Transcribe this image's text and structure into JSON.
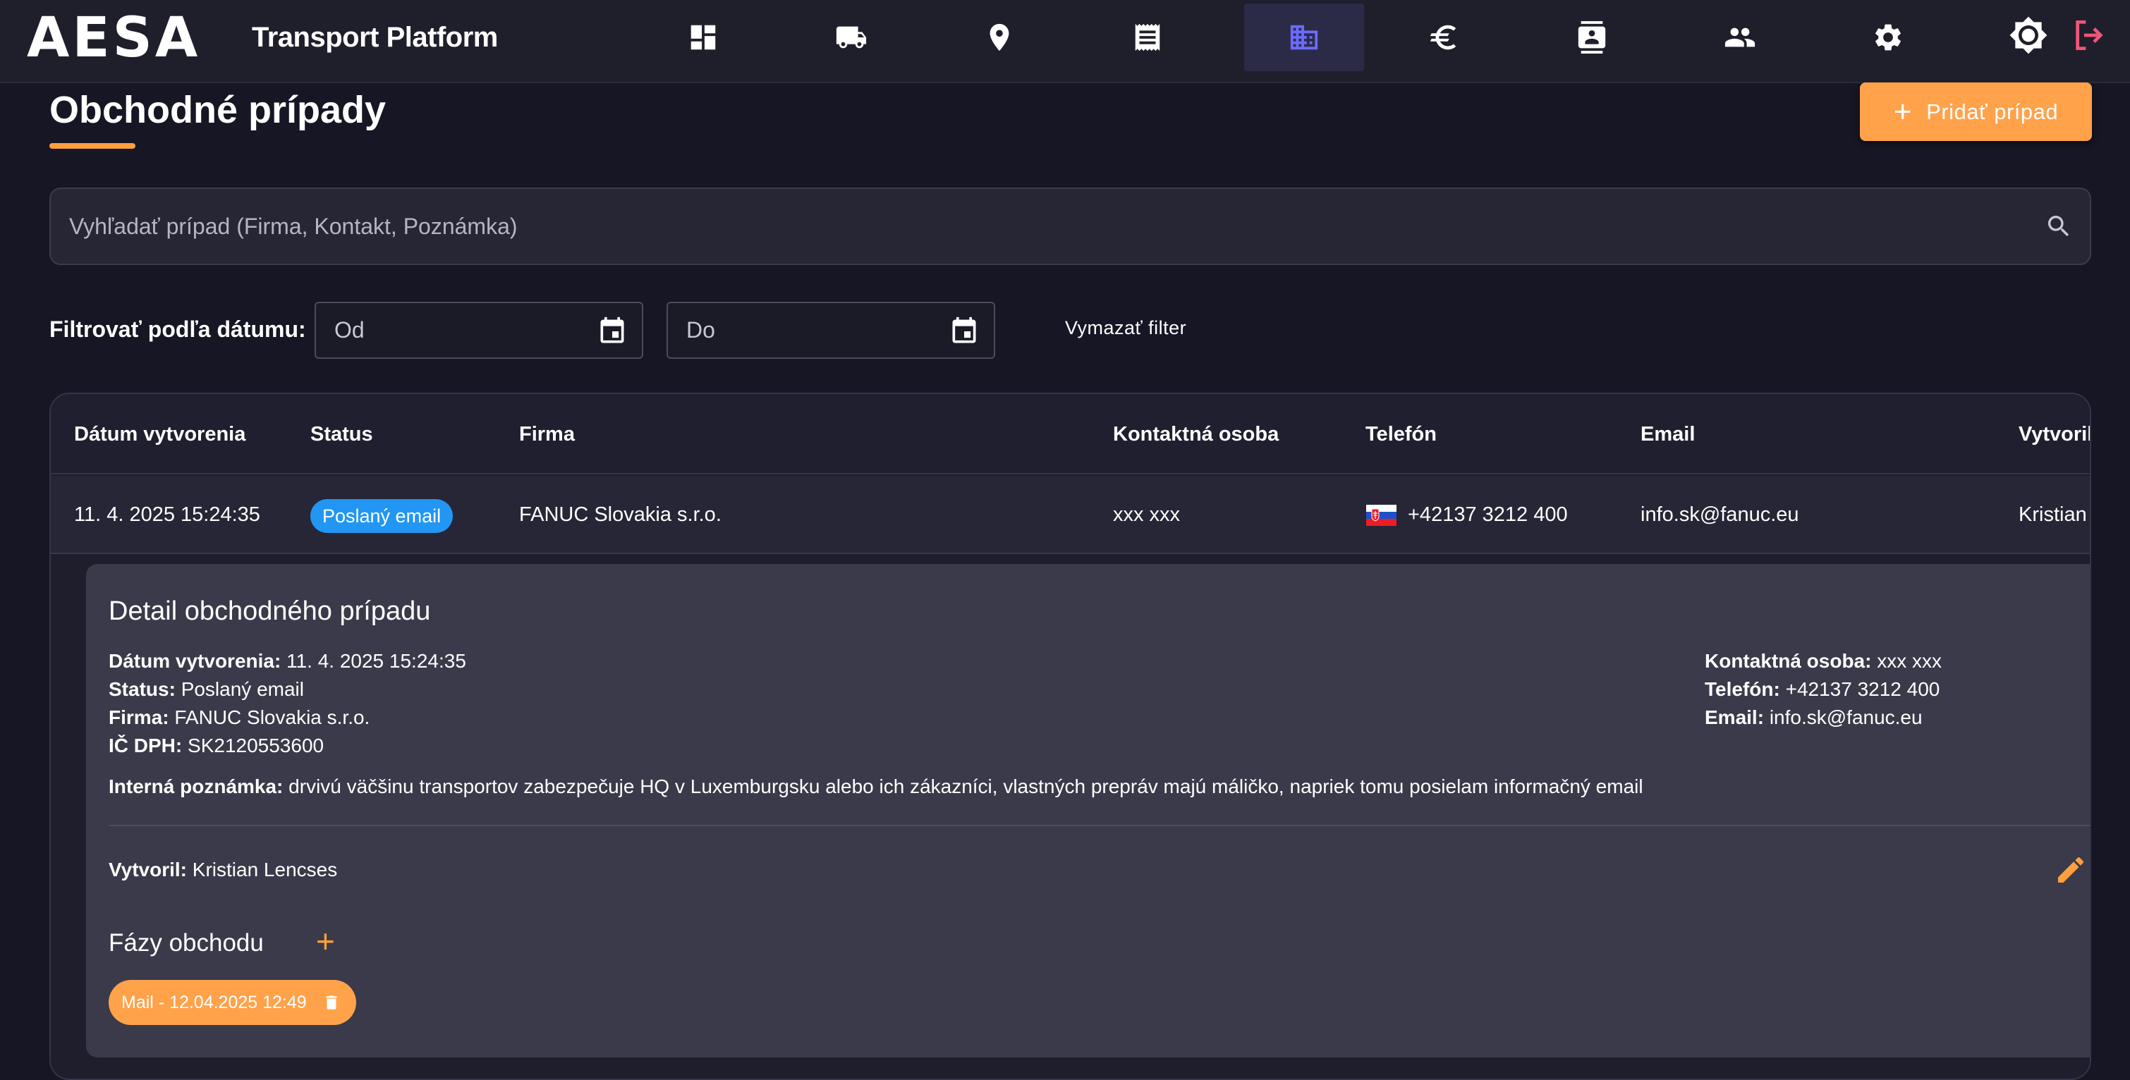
{
  "app": {
    "logo": "AESA",
    "name": "Transport Platform"
  },
  "nav": [
    {
      "icon": "dashboard-icon"
    },
    {
      "icon": "truck-icon"
    },
    {
      "icon": "location-pin-icon"
    },
    {
      "icon": "receipt-icon"
    },
    {
      "icon": "business-icon",
      "active": true
    },
    {
      "icon": "euro-icon"
    },
    {
      "icon": "contacts-icon"
    },
    {
      "icon": "people-icon"
    },
    {
      "icon": "gear-icon"
    }
  ],
  "header_right": [
    "theme-toggle-icon",
    "logout-icon"
  ],
  "page": {
    "title": "Obchodné prípady",
    "add_button": "Pridať prípad"
  },
  "search": {
    "placeholder": "Vyhľadať prípad (Firma, Kontakt, Poznámka)"
  },
  "filter": {
    "label": "Filtrovať podľa dátumu:",
    "from_placeholder": "Od",
    "to_placeholder": "Do",
    "clear": "Vymazať filter"
  },
  "table": {
    "headers": [
      "Dátum vytvorenia",
      "Status",
      "Firma",
      "Kontaktná osoba",
      "Telefón",
      "Email",
      "Vytvoril"
    ],
    "rows": [
      {
        "date": "11. 4. 2025 15:24:35",
        "status": "Poslaný email",
        "company": "FANUC Slovakia s.r.o.",
        "contact": "xxx xxx",
        "phone": "+42137 3212 400",
        "email": "info.sk@fanuc.eu",
        "created_by": "Kristian"
      }
    ]
  },
  "detail": {
    "title": "Detail obchodného prípadu",
    "date_label": "Dátum vytvorenia:",
    "date": "11. 4. 2025 15:24:35",
    "status_label": "Status:",
    "status": "Poslaný email",
    "company_label": "Firma:",
    "company": "FANUC Slovakia s.r.o.",
    "vat_label": "IČ DPH:",
    "vat": "SK2120553600",
    "contact_label": "Kontaktná osoba:",
    "contact": "xxx xxx",
    "phone_label": "Telefón:",
    "phone": "+42137 3212 400",
    "email_label": "Email:",
    "email": "info.sk@fanuc.eu",
    "note_label": "Interná poznámka:",
    "note": "drvivú väčšinu transportov zabezpečuje HQ v Luxemburgsku alebo ich zákazníci, vlastných prepráv majú máličko, napriek tomu posielam informačný email",
    "creator_label": "Vytvoril:",
    "creator": "Kristian Lencses",
    "phases_title": "Fázy obchodu",
    "phases": [
      {
        "label": "Mail - 12.04.2025 12:49"
      }
    ]
  },
  "colors": {
    "accent": "#ffa24a",
    "status_badge": "#2196f3",
    "active_nav_icon": "#6b6bff",
    "logout": "#f0567a"
  }
}
